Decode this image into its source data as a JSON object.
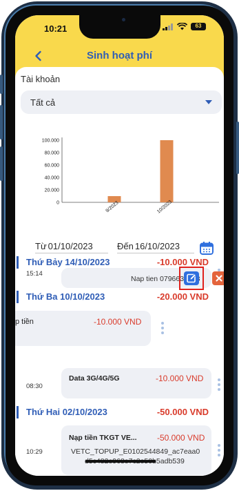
{
  "status_bar": {
    "time": "10:21",
    "battery": "63"
  },
  "header": {
    "title": "Sinh hoạt phí"
  },
  "account": {
    "label": "Tài khoản",
    "selected": "Tất cả"
  },
  "chart_data": {
    "type": "bar",
    "categories": [
      "9/2023",
      "10/2023"
    ],
    "values": [
      10000,
      100000
    ],
    "ylim": [
      0,
      100000
    ],
    "yticks": [
      "0",
      "20.000",
      "40.000",
      "60.000",
      "80.000",
      "100.000"
    ],
    "grid": false,
    "bar_color": "#e08a4f"
  },
  "date_range": {
    "from_label": "Từ",
    "from_value": "01/10/2023",
    "to_label": "Đến",
    "to_value": "16/10/2023"
  },
  "days": [
    {
      "date": "Thứ Bảy 14/10/2023",
      "total": "-10.000 VND",
      "transactions": [
        {
          "time": "15:14",
          "note": "Nap tien 0796635398"
        }
      ]
    },
    {
      "date": "Thứ Ba 10/10/2023",
      "total": "-20.000 VND",
      "transactions": [
        {
          "name": "p tiền",
          "amount": "-10.000 VND"
        },
        {
          "time": "08:30",
          "name": "Data 3G/4G/5G",
          "amount": "-10.000 VND"
        }
      ]
    },
    {
      "date": "Thứ Hai 02/10/2023",
      "total": "-50.000 VND",
      "transactions": [
        {
          "time": "10:29",
          "name": "Nạp tiền TKGT VE...",
          "amount": "-50.000 VND",
          "note_line1": "VETC_TOPUP_E0102544849_ac7eaa0",
          "note_line2": "d5c482e968e7c2e50b5adb539"
        }
      ]
    }
  ],
  "colors": {
    "accent": "#2f5db6",
    "header_bg": "#f9d94c",
    "negative": "#d93b2b",
    "edit": "#2f6fde",
    "delete": "#e4643c",
    "highlight": "#e0201b"
  },
  "icons": [
    "back-arrow-icon",
    "calendar-icon",
    "edit-icon",
    "close-icon",
    "more-vertical-icon",
    "signal-icon",
    "wifi-icon",
    "battery-icon"
  ]
}
